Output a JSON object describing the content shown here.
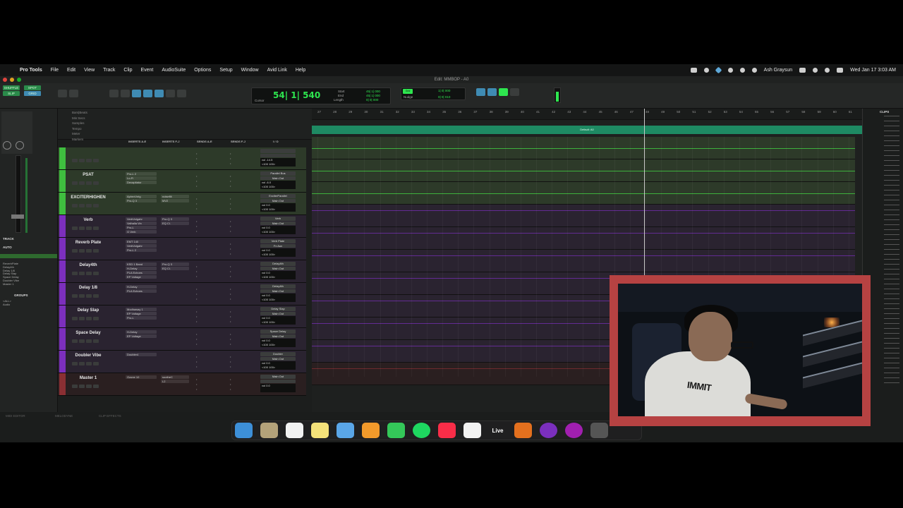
{
  "menubar": {
    "app": "Pro Tools",
    "menus": [
      "File",
      "Edit",
      "View",
      "Track",
      "Clip",
      "Event",
      "AudioSuite",
      "Options",
      "Setup",
      "Window",
      "Avid Link",
      "Help"
    ],
    "user": "Ash Graysun",
    "datetime": "Wed Jan 17  3:03 AM"
  },
  "window": {
    "title": "Edit: MMBOP - A0"
  },
  "toolbar": {
    "modes": [
      "SHUFFLE",
      "SPOT",
      "SLIP",
      "GRID"
    ],
    "counter_main": "54| 1| 540",
    "cursor_label": "Cursor",
    "start_label": "Start",
    "end_label": "End",
    "length_label": "Length",
    "start_val": "45| 1| 000",
    "end_val": "45| 1| 000",
    "length_val": "0| 0| 000",
    "grid_label": "Grid",
    "nudge_label": "Nudge",
    "grid_val": "1| 0| 000",
    "nudge_val": "0| 0| 010"
  },
  "ruler": {
    "names": [
      "Bars|Beats",
      "Min:Secs",
      "Samples",
      "Tempo",
      "Meter",
      "Markers"
    ],
    "bars": [
      "27",
      "28",
      "29",
      "30",
      "31",
      "32",
      "33",
      "34",
      "35",
      "36",
      "37",
      "38",
      "39",
      "40",
      "41",
      "42",
      "43",
      "44",
      "45",
      "46",
      "47",
      "48",
      "49",
      "50",
      "51",
      "52",
      "53",
      "54",
      "55",
      "56",
      "57",
      "58",
      "59",
      "60",
      "61"
    ],
    "marker": "Default: A0"
  },
  "mix_columns": [
    "INSERTS A-E",
    "INSERTS F-J",
    "SENDS A-E",
    "SENDS F-J",
    "I / O"
  ],
  "tracks": [
    {
      "name": "",
      "color": "#3fbf3f",
      "lane": "#2d3a29",
      "ins1": [],
      "ins2": [],
      "io": [
        "",
        "",
        "vol  -14.5",
        "<100  100>"
      ]
    },
    {
      "name": "PSAT",
      "color": "#3fbf3f",
      "lane": "#2d3a29",
      "ins1": [
        "Pro-L 2",
        "Lo-Fi",
        "Decapitator"
      ],
      "ins2": [],
      "io": [
        "Parallel Bus",
        "Main Out",
        "vol  -6.0",
        "<100  100>"
      ]
    },
    {
      "name": "EXCITERHIGHEN",
      "color": "#3fbf3f",
      "lane": "#2d3a29",
      "ins1": [
        "AphexVntg",
        "Pro-Q 3"
      ],
      "ins2": [
        "noisefilt",
        "MV2"
      ],
      "io": [
        "ExciterParallel",
        "Main Out",
        "vol  0.0",
        "<100  100>"
      ]
    },
    {
      "name": "Verb",
      "color": "#7c2fbe",
      "lane": "#2a2330",
      "ins1": [
        "VerbVolgahr",
        "Valhalla Vin",
        "Pro-L",
        "G Verb"
      ],
      "ins2": [
        "Pro-Q 3",
        "EQ Cl."
      ],
      "io": [
        "Verb",
        "Main Out",
        "vol  0.0",
        "<100  100>"
      ]
    },
    {
      "name": "Reverb Plate",
      "color": "#7c2fbe",
      "lane": "#2a2330",
      "ins1": [
        "EMT 140",
        "VerbVolgahr",
        "Pro-L 2"
      ],
      "ins2": [],
      "io": [
        "Verb Plate",
        "Fx Aux",
        "vol  0.0",
        "<100  100>"
      ]
    },
    {
      "name": "Delay4th",
      "color": "#7c2fbe",
      "lane": "#2a2330",
      "ins1": [
        "KSD 1 Band",
        "H-Delay",
        "PLA Echoes",
        "EP Voltage"
      ],
      "ins2": [
        "Pro-Q 3",
        "EQ Cl."
      ],
      "io": [
        "Delay4th",
        "Main Out",
        "vol  0.0",
        "<100  100>"
      ]
    },
    {
      "name": "Delay 1/8",
      "color": "#7c2fbe",
      "lane": "#2a2330",
      "ins1": [
        "H-Delay",
        "PLA Echoes"
      ],
      "ins2": [],
      "io": [
        "Delay4th",
        "Main Out",
        "vol  0.0",
        "<100  100>"
      ]
    },
    {
      "name": "Delay Slap",
      "color": "#7c2fbe",
      "lane": "#2a2330",
      "ins1": [
        "Modhaway 1",
        "EP Voltage",
        "Pro-L"
      ],
      "ins2": [],
      "io": [
        "Delay Slap",
        "Main Out",
        "vol  0.0",
        "<100  100>"
      ]
    },
    {
      "name": "Space Delay",
      "color": "#7c2fbe",
      "lane": "#2a2330",
      "ins1": [
        "H-Delay",
        "EP Voltage"
      ],
      "ins2": [],
      "io": [
        "Space Delay",
        "Main Out",
        "vol  0.0",
        "<100  100>"
      ]
    },
    {
      "name": "Doubler Vibe",
      "color": "#7c2fbe",
      "lane": "#2a2330",
      "ins1": [
        "Doubler4"
      ],
      "ins2": [],
      "io": [
        "Doubler",
        "Main Out",
        "vol  0.0",
        "<100  100>"
      ]
    },
    {
      "name": "Master 1",
      "color": "#8a2f33",
      "lane": "#2a1f20",
      "ins1": [
        "Ozone 10"
      ],
      "ins2": [
        "sootheC",
        "L2"
      ],
      "io": [
        "Main Out",
        "",
        "vol  0.0",
        ""
      ]
    }
  ],
  "left_panel": {
    "track_label": "TRACK",
    "auto_label": "AUTO",
    "groups_label": "GROUPS",
    "track_list": [
      "ReverbPlate",
      "Delay4th",
      "Delay 1/8",
      "Delay Slap",
      "Space Delay",
      "Doubler Vibe",
      "Master 1",
      "Rev Auxv",
      "Master"
    ],
    "groups": [
      "<ALL>",
      "Audio"
    ]
  },
  "bottom": {
    "left_tab": "MIDI EDITOR",
    "melodyne": "MELODYNE",
    "clip_effects": "CLIP EFFECTS"
  },
  "right_panel": {
    "label": "CLIPS"
  },
  "dock": {
    "live_label": "Live"
  }
}
